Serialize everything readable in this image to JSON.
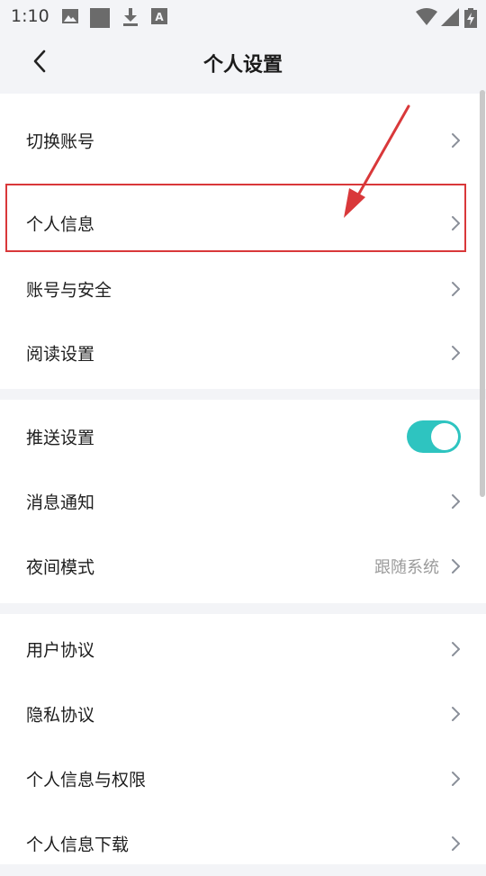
{
  "status_bar": {
    "time": "1:10",
    "icons": [
      "image-icon",
      "square-icon",
      "download-icon",
      "font-a-icon",
      "wifi-icon",
      "signal-icon",
      "battery-charging-icon"
    ]
  },
  "header": {
    "title": "个人设置",
    "back_icon": "chevron-left-icon"
  },
  "groups": [
    {
      "items": [
        {
          "label": "切换账号",
          "type": "link"
        },
        {
          "label": "个人信息",
          "type": "link",
          "highlighted": true
        },
        {
          "label": "账号与安全",
          "type": "link"
        },
        {
          "label": "阅读设置",
          "type": "link"
        }
      ]
    },
    {
      "items": [
        {
          "label": "推送设置",
          "type": "toggle",
          "on": true
        },
        {
          "label": "消息通知",
          "type": "link"
        },
        {
          "label": "夜间模式",
          "type": "link",
          "value": "跟随系统"
        }
      ]
    },
    {
      "items": [
        {
          "label": "用户协议",
          "type": "link"
        },
        {
          "label": "隐私协议",
          "type": "link"
        },
        {
          "label": "个人信息与权限",
          "type": "link"
        },
        {
          "label": "个人信息下载",
          "type": "link"
        }
      ]
    }
  ],
  "colors": {
    "background": "#f3f4f7",
    "toggle_on": "#2ec4c0",
    "highlight": "#d9383a",
    "value_text": "#9b9b9b"
  }
}
